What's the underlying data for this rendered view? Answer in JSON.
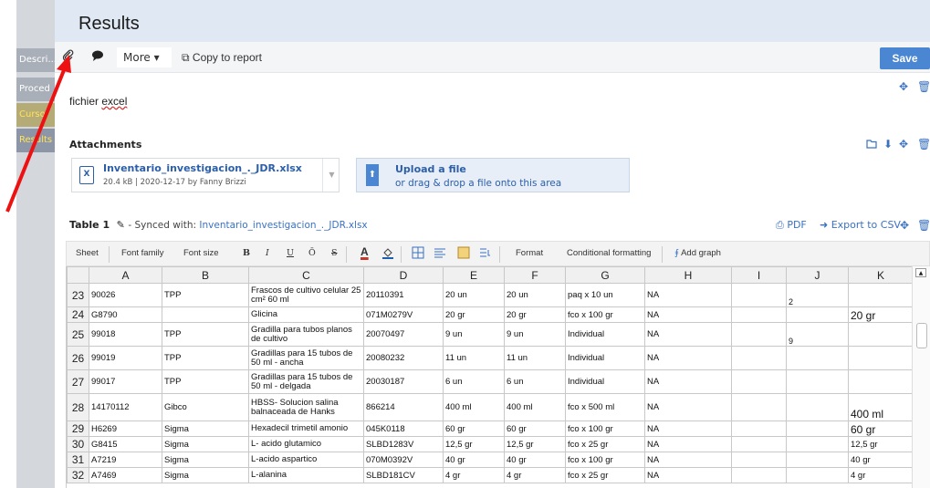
{
  "sidebar": {
    "items": [
      {
        "label": "Descri..."
      },
      {
        "label": "Proced"
      },
      {
        "label": "Curso"
      },
      {
        "label": "Results"
      }
    ]
  },
  "header": {
    "title": "Results"
  },
  "toolbar": {
    "more_label": "More ▾",
    "copy_label": "Copy to report",
    "save_label": "Save"
  },
  "note": {
    "text_prefix": "fichier ",
    "text_misspelled": "excel"
  },
  "attachments": {
    "label": "Attachments",
    "file": {
      "icon_letter": "X",
      "name": "Inventario_investigacion_._JDR.xlsx",
      "meta": "20.4 kB | 2020-12-17 by Fanny Brizzi"
    },
    "upload": {
      "title": "Upload a file",
      "subtitle": "or drag & drop a file onto this area"
    }
  },
  "table": {
    "title": "Table 1",
    "synced_prefix": " - Synced with: ",
    "synced_file": "Inventario_investigacion_._JDR.xlsx",
    "pdf_label": "PDF",
    "export_label": "Export to CSV"
  },
  "sheet_toolbar": {
    "sheet": "Sheet",
    "font_family": "Font family",
    "font_size": "Font size",
    "bold": "B",
    "italic": "I",
    "underline": "U",
    "overline": "Ō",
    "strike": "S",
    "format": "Format",
    "conditional": "Conditional formatting",
    "add_graph": "Add graph"
  },
  "grid": {
    "columns": [
      "A",
      "B",
      "C",
      "D",
      "E",
      "F",
      "G",
      "H",
      "I",
      "J",
      "K"
    ],
    "rows": [
      {
        "n": "23",
        "a": "90026",
        "b": "TPP",
        "c": "Frascos de cultivo celular 25 cm² 60 ml",
        "d": "20110391",
        "e": "20 un",
        "f": "20 un",
        "g": "paq x 10 un",
        "h": "NA",
        "i": "",
        "j": "2",
        "k": ""
      },
      {
        "n": "24",
        "a": "G8790",
        "b": "",
        "c": "Glicina",
        "d": "071M0279V",
        "e": "20 gr",
        "f": "20 gr",
        "g": "fco x 100 gr",
        "h": "NA",
        "i": "",
        "j": "",
        "k": "20 gr"
      },
      {
        "n": "25",
        "a": "99018",
        "b": "TPP",
        "c": "Gradilla para tubos planos de cultivo",
        "d": "20070497",
        "e": "9 un",
        "f": "9 un",
        "g": "Individual",
        "h": "NA",
        "i": "",
        "j": "9",
        "k": ""
      },
      {
        "n": "26",
        "a": "99019",
        "b": "TPP",
        "c": "Gradillas para 15 tubos de 50 ml -  ancha",
        "d": "20080232",
        "e": "11 un",
        "f": "11 un",
        "g": "Individual",
        "h": "NA",
        "i": "",
        "j": "",
        "k": ""
      },
      {
        "n": "27",
        "a": "99017",
        "b": "TPP",
        "c": "Gradillas para 15 tubos de 50 ml -  delgada",
        "d": "20030187",
        "e": "6 un",
        "f": "6 un",
        "g": "Individual",
        "h": "NA",
        "i": "",
        "j": "",
        "k": ""
      },
      {
        "n": "28",
        "a": "14170112",
        "b": "Gibco",
        "c": "HBSS- Solucion salina balnaceada de Hanks",
        "d": "866214",
        "e": "400 ml",
        "f": "400 ml",
        "g": "fco x 500 ml",
        "h": "NA",
        "i": "",
        "j": "",
        "k": "400 ml"
      },
      {
        "n": "29",
        "a": "H6269",
        "b": "Sigma",
        "c": "Hexadecil trimetil amonio",
        "d": "045K0118",
        "e": "60 gr",
        "f": "60 gr",
        "g": "fco x 100 gr",
        "h": "NA",
        "i": "",
        "j": "",
        "k": "60 gr"
      },
      {
        "n": "30",
        "a": "G8415",
        "b": "Sigma",
        "c": "L- acido glutamico",
        "d": "SLBD1283V",
        "e": "12,5 gr",
        "f": "12,5 gr",
        "g": "fco x 25 gr",
        "h": "NA",
        "i": "",
        "j": "",
        "k": "12,5 gr"
      },
      {
        "n": "31",
        "a": "A7219",
        "b": "Sigma",
        "c": "L-acido aspartico",
        "d": "070M0392V",
        "e": "40 gr",
        "f": "40 gr",
        "g": "fco x 100 gr",
        "h": "NA",
        "i": "",
        "j": "",
        "k": "40 gr"
      },
      {
        "n": "32",
        "a": "A7469",
        "b": "Sigma",
        "c": "L-alanina",
        "d": "SLBD181CV",
        "e": "4 gr",
        "f": "4 gr",
        "g": "fco x 25 gr",
        "h": "NA",
        "i": "",
        "j": "",
        "k": "4 gr"
      }
    ]
  }
}
